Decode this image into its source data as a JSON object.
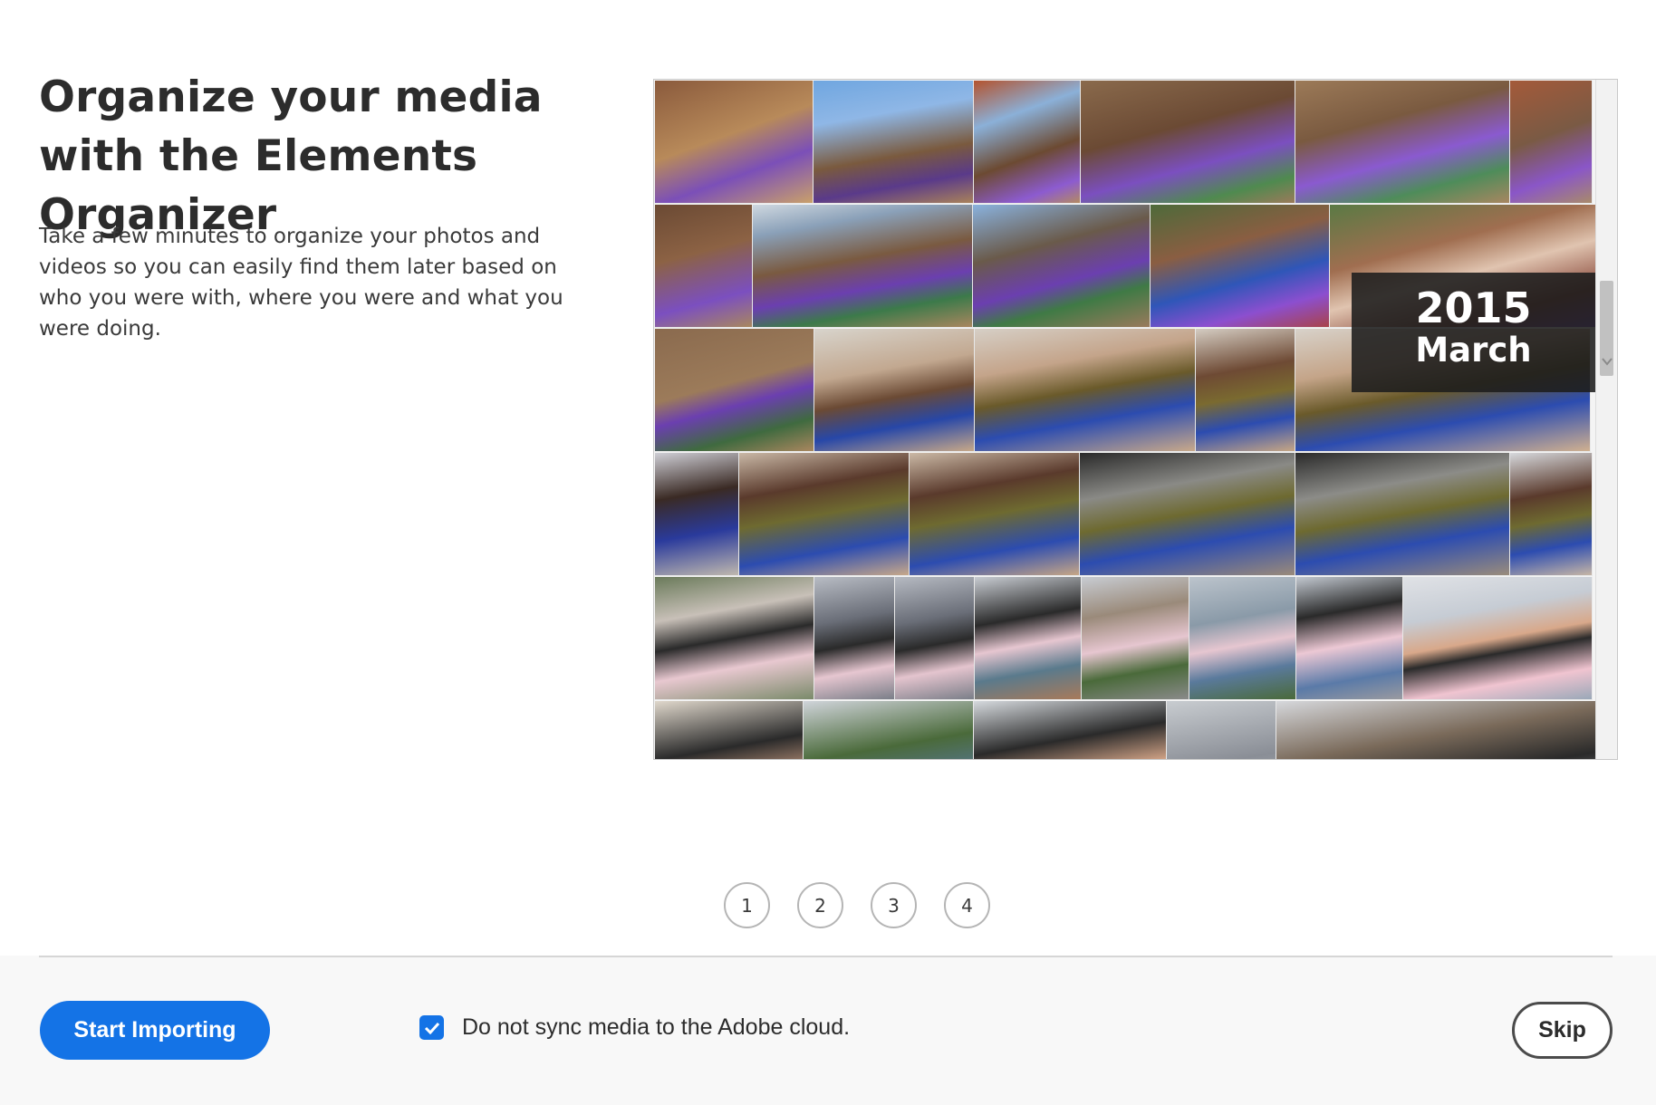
{
  "headline": "Organize your media with the Elements Organizer",
  "description": "Take a few minutes to organize your photos and videos so you can easily find them later based on who you were with, where you were and what you were doing.",
  "viewer": {
    "date_overlay": {
      "year": "2015",
      "month": "March"
    },
    "scroll_up_icon": "chevron-up-icon",
    "scroll_down_icon": "chevron-down-icon"
  },
  "pager": {
    "pages": [
      "1",
      "2",
      "3",
      "4"
    ]
  },
  "footer": {
    "start_button": "Start Importing",
    "sync_checkbox": {
      "label": "Do not sync media to the Adobe cloud.",
      "checked": true
    },
    "skip_button": "Skip"
  },
  "colors": {
    "accent": "#1473e6",
    "checkbox": "#1473e6",
    "overlay": "#1c1c1c"
  }
}
